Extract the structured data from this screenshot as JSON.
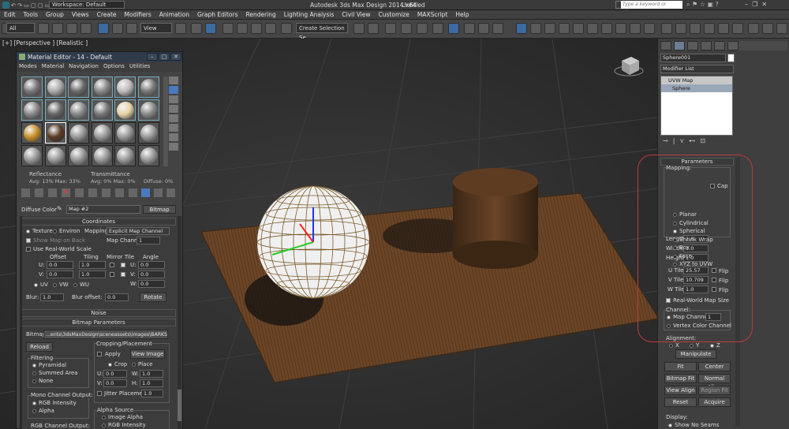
{
  "app": {
    "workspace": "Workspace: Default",
    "title": "Autodesk 3ds Max Design 2014 x64",
    "doc": "Untitled",
    "search_placeholder": "Type a keyword or phrase"
  },
  "menu": [
    "Edit",
    "Tools",
    "Group",
    "Views",
    "Create",
    "Modifiers",
    "Animation",
    "Graph Editors",
    "Rendering",
    "Lighting Analysis",
    "Civil View",
    "Customize",
    "MAXScript",
    "Help"
  ],
  "toolbar": {
    "filter": "All",
    "view": "View",
    "selection_set": "Create Selection Se"
  },
  "viewport": {
    "label": "[+] [Perspective ] [Realistic ]"
  },
  "material_editor": {
    "title": "Material Editor - 14 - Default",
    "menu": [
      "Modes",
      "Material",
      "Navigation",
      "Options",
      "Utilities"
    ],
    "reflectance_label": "Reflectance",
    "reflectance_val": "Avg: 13% Max: 33%",
    "transmittance_label": "Transmittance",
    "transmittance_val": "Avg: 0% Max: 0%",
    "diffuse_val": "Diffuse: 0%",
    "diffuse_color": "Diffuse Color",
    "map_name": "Map #2",
    "map_type": "Bitmap",
    "coord_title": "Coordinates",
    "texture": "Texture",
    "environ": "Environ",
    "mapping_label": "Mapping:",
    "mapping_val": "Explicit Map Channel",
    "show_map": "Show Map on Back",
    "map_channel_label": "Map Channel:",
    "map_channel_val": "1",
    "real_world": "Use Real-World Scale",
    "offset": "Offset",
    "tiling": "Tiling",
    "mirror_tile": "Mirror Tile",
    "angle": "Angle",
    "u": "U:",
    "v": "V:",
    "w": "W:",
    "u_offset": "0.0",
    "v_offset": "0.0",
    "u_tiling": "1.0",
    "v_tiling": "1.0",
    "u_angle": "0.0",
    "v_angle": "0.0",
    "w_angle": "0.0",
    "uv": "UV",
    "vw": "VW",
    "wu": "WU",
    "blur_label": "Blur:",
    "blur_val": "1.0",
    "blur_offset_label": "Blur offset:",
    "blur_offset_val": "0.0",
    "rotate": "Rotate",
    "noise": "Noise",
    "bitmap_params": "Bitmap Parameters",
    "bitmap_label": "Bitmap:",
    "bitmap_path": "...ents\\3dsMaxDesign\\sceneassets\\images\\BARKS.jpg",
    "reload": "Reload",
    "cropping": "Cropping/Placement",
    "apply": "Apply",
    "view_image": "View Image",
    "crop": "Crop",
    "place": "Place",
    "crop_u": "0.0",
    "crop_v": "0.0",
    "crop_w": "1.0",
    "crop_h": "1.0",
    "w_lbl": "W:",
    "h_lbl": "H:",
    "jitter": "Jitter Placement:",
    "jitter_val": "1.0",
    "filtering": "Filtering",
    "pyramidal": "Pyramidal",
    "summed": "Summed Area",
    "none": "None",
    "mono": "Mono Channel Output:",
    "rgb_int": "RGB Intensity",
    "alpha": "Alpha",
    "alpha_src": "Alpha Source",
    "image_alpha": "Image Alpha",
    "rgb_intensity": "RGB Intensity",
    "rgb_out": "RGB Channel Output:"
  },
  "command_panel": {
    "object_name": "Sphere001",
    "modifier_list": "Modifier List",
    "stack": [
      "UVW Map",
      "Sphere"
    ],
    "params_title": "Parameters",
    "mapping": "Mapping:",
    "mapping_types": [
      "Planar",
      "Cylindrical",
      "Spherical",
      "Shrink Wrap",
      "Box",
      "Face",
      "XYZ to UVW"
    ],
    "cap": "Cap",
    "length": "Length:",
    "width": "Width:",
    "height": "Height:",
    "length_val": "1.0",
    "width_val": "1.0",
    "height_val": "1.0",
    "u_tile": "U Tile:",
    "v_tile": "V Tile:",
    "w_tile": "W Tile:",
    "u_tile_val": "25.57",
    "v_tile_val": "10.709",
    "w_tile_val": "1.0",
    "flip": "Flip",
    "real_world": "Real-World Map Size",
    "channel": "Channel:",
    "map_channel": "Map Channel:",
    "map_channel_val": "1",
    "vertex_color": "Vertex Color Channel",
    "alignment": "Alignment:",
    "x": "X",
    "y": "Y",
    "z": "Z",
    "manipulate": "Manipulate",
    "fit": "Fit",
    "center": "Center",
    "bitmap_fit": "Bitmap Fit",
    "normal_align": "Normal Align",
    "view_align": "View Align",
    "region_fit": "Region Fit",
    "reset": "Reset",
    "acquire": "Acquire",
    "display": "Display:",
    "show_no_seams": "Show No Seams"
  }
}
